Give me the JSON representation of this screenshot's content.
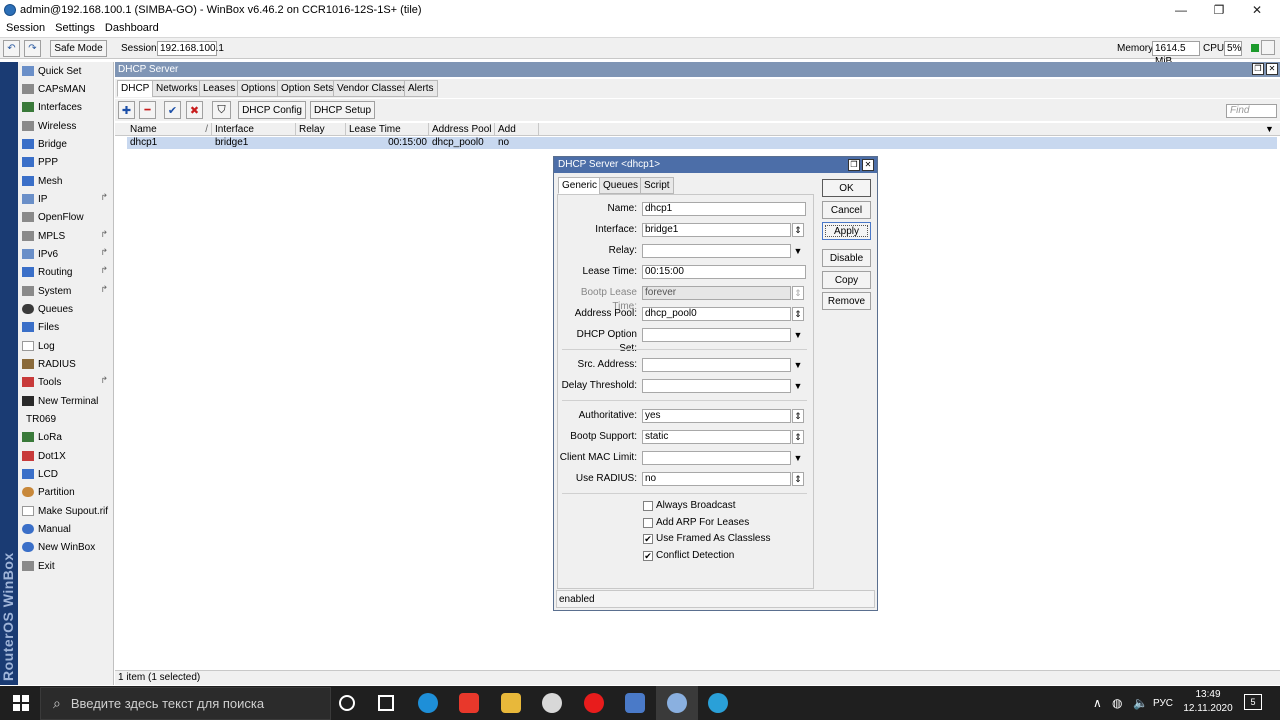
{
  "window": {
    "title": "admin@192.168.100.1 (SIMBA-GO) - WinBox v6.46.2 on CCR1016-12S-1S+ (tile)",
    "minimize_glyph": "—",
    "maximize_glyph": "❐",
    "close_glyph": "✕"
  },
  "menu": {
    "items": [
      "Session",
      "Settings",
      "Dashboard"
    ]
  },
  "toolbar": {
    "undo_glyph": "↶",
    "redo_glyph": "↷",
    "safe_mode_label": "Safe Mode",
    "session_label": "Session:",
    "session_value": "192.168.100.1",
    "memory_label": "Memory:",
    "memory_value": "1614.5 MiB",
    "cpu_label": "CPU:",
    "cpu_value": "5%"
  },
  "brand_text": "RouterOS WinBox",
  "sidebar": {
    "items": [
      {
        "label": "Quick Set",
        "arrow": "",
        "color": "#6a8fc8"
      },
      {
        "label": "CAPsMAN",
        "arrow": "",
        "color": "#8a8a8a"
      },
      {
        "label": "Interfaces",
        "arrow": "",
        "color": "#3a7a3a"
      },
      {
        "label": "Wireless",
        "arrow": "",
        "color": "#8a8a8a"
      },
      {
        "label": "Bridge",
        "arrow": "",
        "color": "#3a6fc8"
      },
      {
        "label": "PPP",
        "arrow": "",
        "color": "#3a6fc8"
      },
      {
        "label": "Mesh",
        "arrow": "",
        "color": "#3a6fc8"
      },
      {
        "label": "IP",
        "arrow": "↱",
        "color": "#6a8fc8"
      },
      {
        "label": "OpenFlow",
        "arrow": "",
        "color": "#8a8a8a"
      },
      {
        "label": "MPLS",
        "arrow": "↱",
        "color": "#8a8a8a"
      },
      {
        "label": "IPv6",
        "arrow": "↱",
        "color": "#6a8fc8"
      },
      {
        "label": "Routing",
        "arrow": "↱",
        "color": "#3a6fc8"
      },
      {
        "label": "System",
        "arrow": "↱",
        "color": "#8a8a8a"
      },
      {
        "label": "Queues",
        "arrow": "",
        "color": "#3a3a3a"
      },
      {
        "label": "Files",
        "arrow": "",
        "color": "#3a6fc8"
      },
      {
        "label": "Log",
        "arrow": "",
        "color": "#c8c8c8"
      },
      {
        "label": "RADIUS",
        "arrow": "",
        "color": "#8a6a3a"
      },
      {
        "label": "Tools",
        "arrow": "↱",
        "color": "#c83a3a"
      },
      {
        "label": "New Terminal",
        "arrow": "",
        "color": "#2a2a2a"
      },
      {
        "label": "TR069",
        "arrow": "",
        "color": ""
      },
      {
        "label": "LoRa",
        "arrow": "",
        "color": "#3a7a3a"
      },
      {
        "label": "Dot1X",
        "arrow": "",
        "color": "#c83a3a"
      },
      {
        "label": "LCD",
        "arrow": "",
        "color": "#3a6fc8"
      },
      {
        "label": "Partition",
        "arrow": "",
        "color": "#c8883a"
      },
      {
        "label": "Make Supout.rif",
        "arrow": "",
        "color": "#c8c8c8"
      },
      {
        "label": "Manual",
        "arrow": "",
        "color": "#3a6fc8"
      },
      {
        "label": "New WinBox",
        "arrow": "",
        "color": "#3a6fc8"
      },
      {
        "label": "Exit",
        "arrow": "",
        "color": "#8a8a8a"
      }
    ]
  },
  "dhcp_window": {
    "title": "DHCP Server",
    "tabs": [
      "DHCP",
      "Networks",
      "Leases",
      "Options",
      "Option Sets",
      "Vendor Classes",
      "Alerts"
    ],
    "active_tab": "DHCP",
    "buttons": {
      "add": "✚",
      "remove": "━",
      "enable": "✔",
      "disable": "✖",
      "filter": "⛉",
      "dhcp_config": "DHCP Config",
      "dhcp_setup": "DHCP Setup"
    },
    "find_placeholder": "Find",
    "columns": [
      "Name",
      "Interface",
      "Relay",
      "Lease Time",
      "Address Pool",
      "Add AR..."
    ],
    "sort_indicator": "/",
    "rows": [
      {
        "name": "dhcp1",
        "interface": "bridge1",
        "relay": "",
        "lease_time": "00:15:00",
        "address_pool": "dhcp_pool0",
        "add_arp": "no"
      }
    ],
    "status": "1 item (1 selected)"
  },
  "dialog": {
    "title": "DHCP Server <dhcp1>",
    "tabs": [
      "Generic",
      "Queues",
      "Script"
    ],
    "active_tab": "Generic",
    "fields": {
      "name": {
        "label": "Name:",
        "value": "dhcp1"
      },
      "interface": {
        "label": "Interface:",
        "value": "bridge1"
      },
      "relay": {
        "label": "Relay:",
        "value": ""
      },
      "lease_time": {
        "label": "Lease Time:",
        "value": "00:15:00"
      },
      "bootp_lease_time": {
        "label": "Bootp Lease Time:",
        "value": "forever"
      },
      "address_pool": {
        "label": "Address Pool:",
        "value": "dhcp_pool0"
      },
      "dhcp_option_set": {
        "label": "DHCP Option Set:",
        "value": ""
      },
      "src_address": {
        "label": "Src. Address:",
        "value": ""
      },
      "delay_threshold": {
        "label": "Delay Threshold:",
        "value": ""
      },
      "authoritative": {
        "label": "Authoritative:",
        "value": "yes"
      },
      "bootp_support": {
        "label": "Bootp Support:",
        "value": "static"
      },
      "client_mac_limit": {
        "label": "Client MAC Limit:",
        "value": ""
      },
      "use_radius": {
        "label": "Use RADIUS:",
        "value": "no"
      }
    },
    "checkboxes": [
      {
        "label": "Always Broadcast",
        "checked": false
      },
      {
        "label": "Add ARP For Leases",
        "checked": false
      },
      {
        "label": "Use Framed As Classless",
        "checked": true
      },
      {
        "label": "Conflict Detection",
        "checked": true
      }
    ],
    "buttons": {
      "ok": "OK",
      "cancel": "Cancel",
      "apply": "Apply",
      "disable": "Disable",
      "copy": "Copy",
      "remove": "Remove"
    },
    "status": "enabled",
    "glyphs": {
      "dropdown": "▼",
      "updown": "⇕",
      "check": "✔",
      "restore": "❐",
      "close": "✕"
    }
  },
  "taskbar": {
    "search_placeholder": "Введите здесь текст для поиска",
    "language": "РУС",
    "time": "13:49",
    "date": "12.11.2020",
    "notification_count": "5",
    "tray_glyphs": {
      "chevron": "∧",
      "network": "◍",
      "volume": "🔈"
    }
  }
}
